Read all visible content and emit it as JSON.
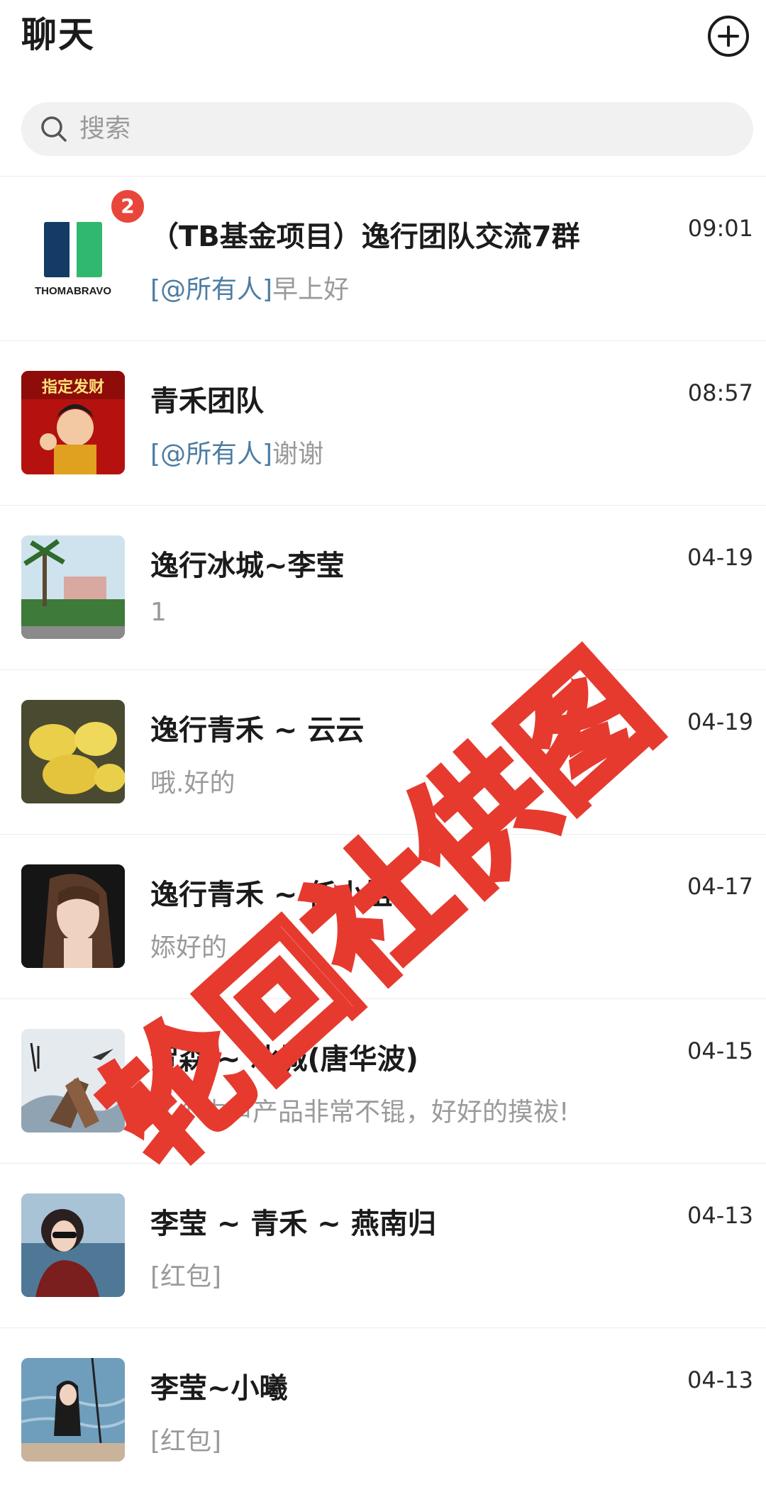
{
  "header": {
    "title": "聊天",
    "add_icon": "plus-circle-icon"
  },
  "search": {
    "placeholder": "搜索",
    "icon": "search-icon"
  },
  "chats": [
    {
      "name": "（TB基金项目）逸行团队交流7群",
      "time": "09:01",
      "mention": "[@所有人]",
      "preview": "早上好",
      "badge": "2",
      "avatar_text": "THOMABRAVO"
    },
    {
      "name": "青禾团队",
      "time": "08:57",
      "mention": "[@所有人]",
      "preview": "谢谢",
      "avatar_text": "指定发财"
    },
    {
      "name": "逸行冰城~李莹",
      "time": "04-19",
      "preview": "1"
    },
    {
      "name": "逸行青禾 ~ 云云",
      "time": "04-19",
      "preview": "哦.好的"
    },
    {
      "name": "逸行青禾 ~ 任小姐",
      "time": "04-17",
      "preview": "婖好的"
    },
    {
      "name": "贺森 ~ 冰城(唐华波)",
      "time": "04-15",
      "preview": "这个生声产品非常不锟，好好的摸祓!"
    },
    {
      "name": "李莹 ~ 青禾 ~ 燕南归",
      "time": "04-13",
      "preview": "[红包]"
    },
    {
      "name": "李莹~小曦",
      "time": "04-13",
      "preview": "[红包]"
    }
  ],
  "watermark": {
    "text": "轮回社供图",
    "color": "#e63a2e"
  },
  "colors": {
    "badge": "#e8463a",
    "mention": "#4d7da3",
    "preview": "#9a9a9a"
  }
}
